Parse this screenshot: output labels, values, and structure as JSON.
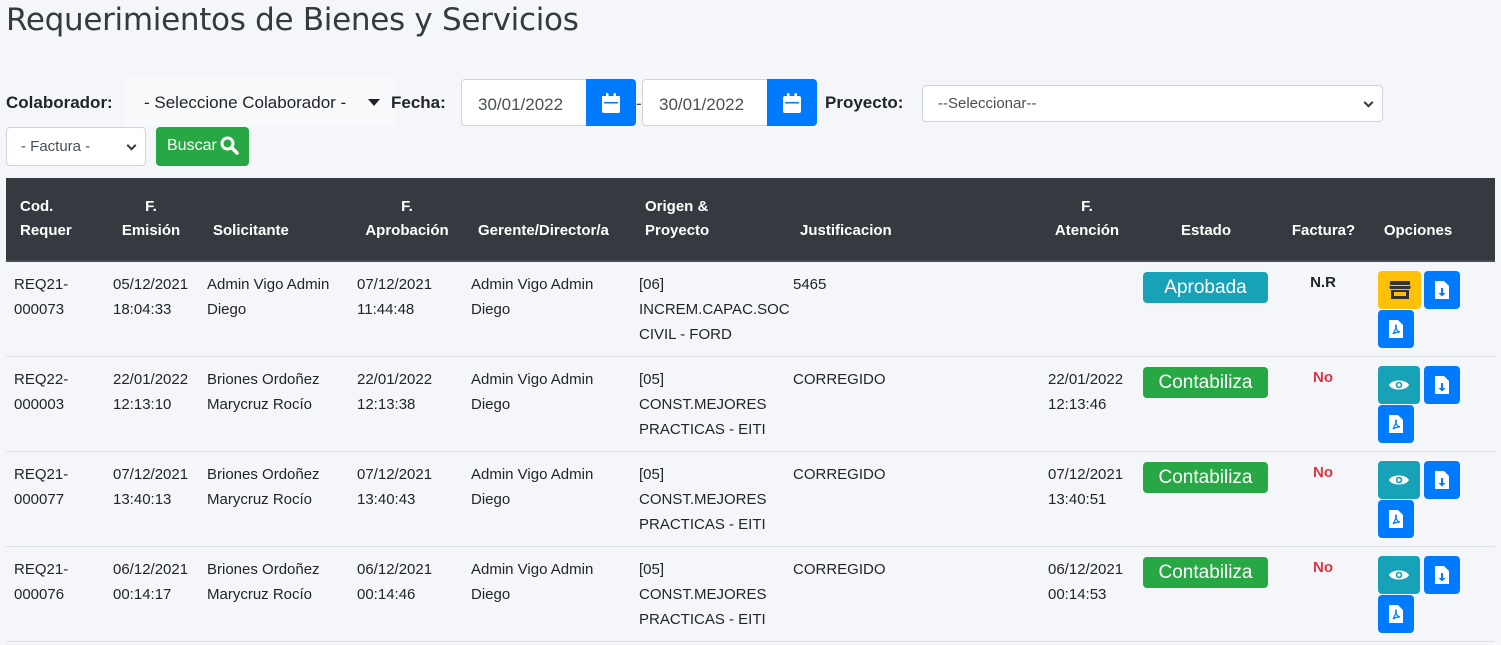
{
  "page": {
    "title": "Requerimientos de Bienes y Servicios"
  },
  "filters": {
    "colaborador_label": "Colaborador:",
    "colaborador_value": "- Seleccione Colaborador -",
    "fecha_label": "Fecha:",
    "fecha_desde": "30/01/2022",
    "fecha_sep": "-",
    "fecha_hasta": "30/01/2022",
    "proyecto_label": "Proyecto:",
    "proyecto_value": "--Seleccionar--",
    "factura_value": "- Factura -",
    "buscar_label": "Buscar"
  },
  "table": {
    "headers": {
      "cod_1": "Cod.",
      "cod_2": "Requer",
      "emision_1": "F.",
      "emision_2": "Emisión",
      "solicitante": "Solicitante",
      "aprob_1": "F.",
      "aprob_2": "Aprobación",
      "gerente": "Gerente/Director/a",
      "origen_1": "Origen &",
      "origen_2": "Proyecto",
      "justificacion": "Justificacion",
      "atencion_1": "F.",
      "atencion_2": "Atención",
      "estado": "Estado",
      "factura": "Factura?",
      "opciones": "Opciones"
    },
    "rows": [
      {
        "cod_1": "REQ21-",
        "cod_2": "000073",
        "emision_1": "05/12/2021",
        "emision_2": "18:04:33",
        "solicitante_1": "Admin Vigo Admin",
        "solicitante_2": "Diego",
        "aprob_1": "07/12/2021",
        "aprob_2": "11:44:48",
        "gerente_1": "Admin Vigo Admin",
        "gerente_2": "Diego",
        "origen_1": "[06]",
        "origen_2": "INCREM.CAPAC.SOC",
        "origen_3": "CIVIL - FORD",
        "justificacion": "5465",
        "atencion_1": "",
        "atencion_2": "",
        "estado": "Aprobada",
        "factura": "N.R"
      },
      {
        "cod_1": "REQ22-",
        "cod_2": "000003",
        "emision_1": "22/01/2022",
        "emision_2": "12:13:10",
        "solicitante_1": "Briones Ordoñez",
        "solicitante_2": "Marycruz Rocío",
        "aprob_1": "22/01/2022",
        "aprob_2": "12:13:38",
        "gerente_1": "Admin Vigo Admin",
        "gerente_2": "Diego",
        "origen_1": "[05]",
        "origen_2": "CONST.MEJORES",
        "origen_3": "PRACTICAS - EITI",
        "justificacion": "CORREGIDO",
        "atencion_1": "22/01/2022",
        "atencion_2": "12:13:46",
        "estado": "Contabiliza",
        "factura": "No"
      },
      {
        "cod_1": "REQ21-",
        "cod_2": "000077",
        "emision_1": "07/12/2021",
        "emision_2": "13:40:13",
        "solicitante_1": "Briones Ordoñez",
        "solicitante_2": "Marycruz Rocío",
        "aprob_1": "07/12/2021",
        "aprob_2": "13:40:43",
        "gerente_1": "Admin Vigo Admin",
        "gerente_2": "Diego",
        "origen_1": "[05]",
        "origen_2": "CONST.MEJORES",
        "origen_3": "PRACTICAS - EITI",
        "justificacion": "CORREGIDO",
        "atencion_1": "07/12/2021",
        "atencion_2": "13:40:51",
        "estado": "Contabiliza",
        "factura": "No"
      },
      {
        "cod_1": "REQ21-",
        "cod_2": "000076",
        "emision_1": "06/12/2021",
        "emision_2": "00:14:17",
        "solicitante_1": "Briones Ordoñez",
        "solicitante_2": "Marycruz Rocío",
        "aprob_1": "06/12/2021",
        "aprob_2": "00:14:46",
        "gerente_1": "Admin Vigo Admin",
        "gerente_2": "Diego",
        "origen_1": "[05]",
        "origen_2": "CONST.MEJORES",
        "origen_3": "PRACTICAS - EITI",
        "justificacion": "CORREGIDO",
        "atencion_1": "06/12/2021",
        "atencion_2": "00:14:53",
        "estado": "Contabiliza",
        "factura": "No"
      }
    ]
  },
  "colors": {
    "header_bg": "#343a40",
    "aprobada": "#17a2b8",
    "contabiliza": "#28a745",
    "factura_no": "#dc3545",
    "primary": "#007bff",
    "warning": "#ffc107"
  },
  "icons": {
    "calendar": "calendar-icon",
    "search": "search-icon",
    "store": "store-icon",
    "eye": "eye-icon",
    "download": "file-download-icon",
    "pdf": "file-pdf-icon"
  }
}
